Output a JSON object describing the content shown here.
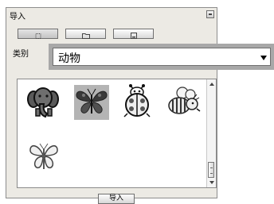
{
  "window": {
    "title": "导入"
  },
  "tabs": [
    {
      "name": "design-view",
      "active": true
    },
    {
      "name": "folder-view",
      "active": false
    },
    {
      "name": "file-view",
      "active": false
    }
  ],
  "category": {
    "label": "类别",
    "value": "动物"
  },
  "designs": [
    {
      "name": "elephant",
      "selected": false
    },
    {
      "name": "butterfly-dark",
      "selected": true
    },
    {
      "name": "ladybug",
      "selected": false
    },
    {
      "name": "bee",
      "selected": false
    },
    {
      "name": "butterfly-light",
      "selected": false
    }
  ],
  "footer": {
    "import_label": "导入"
  }
}
